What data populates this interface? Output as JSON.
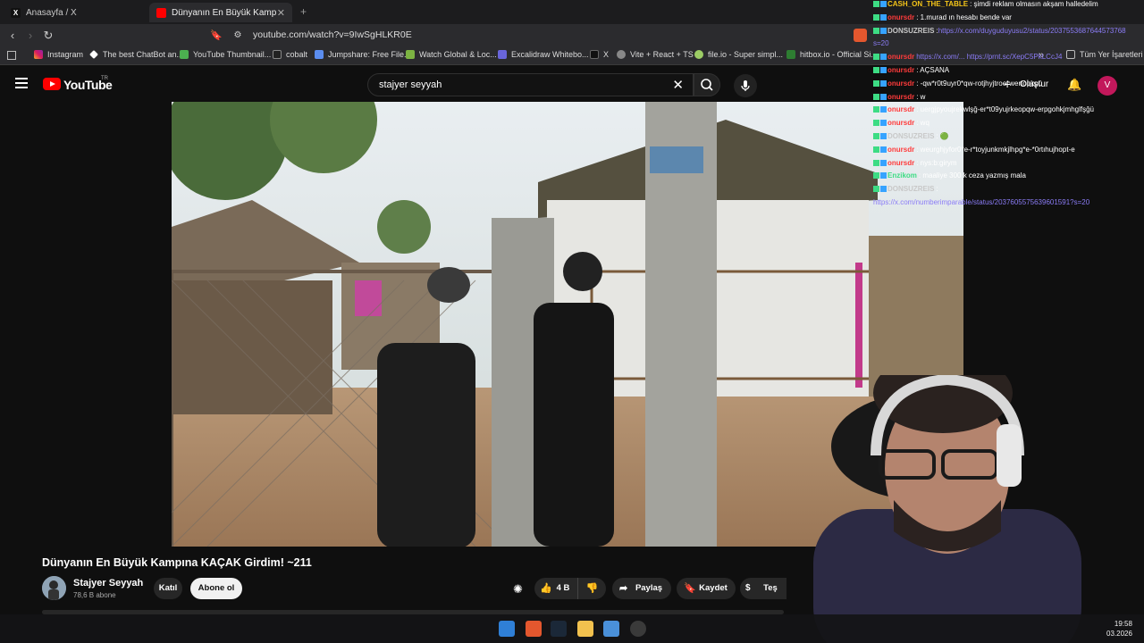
{
  "browser": {
    "tabs": [
      {
        "label": "Anasayfa / X",
        "active": false
      },
      {
        "label": "Dünyanın En Büyük Kampına KAÇ",
        "active": true
      }
    ],
    "url": "youtube.com/watch?v=9IwSgHLKR0E",
    "bookmarks": [
      "Instagram",
      "The best ChatBot an...",
      "YouTube Thumbnail...",
      "cobalt",
      "Jumpshare: Free File...",
      "Watch Global & Loc...",
      "Excalidraw Whitebo...",
      "X",
      "Vite + React + TS",
      "file.io - Super simpl...",
      "hitbox.io - Official Si..."
    ],
    "bookmarks_more": "»",
    "all_bookmarks": "Tüm Yer İşaretleri"
  },
  "youtube": {
    "logo_text": "YouTube",
    "country_code": "TR",
    "search_value": "stajyer seyyah",
    "create_label": "Oluştur",
    "avatar_letter": "V",
    "video": {
      "title": "Dünyanın En Büyük Kampına KAÇAK Girdim! ~211",
      "channel_name": "Stajyer Seyyah",
      "subscribers": "78,6 B abone",
      "join_label": "Katıl",
      "subscribe_label": "Abone ol",
      "likes": "4 B",
      "share_label": "Paylaş",
      "save_label": "Kaydet",
      "thanks_label": "Teş"
    }
  },
  "chat": [
    {
      "user": "CASH_ON_THE_TABLE",
      "user_color": "#f5c518",
      "msg": ": şimdi reklam olmasın akşam halledelim"
    },
    {
      "user": "onursdr",
      "user_color": "#ff3b3b",
      "msg": ": 1.murad ın hesabı bende var"
    },
    {
      "user": "DONSUZREIS",
      "user_color": "#c8c8c8",
      "msg": ": ",
      "link": "https://x.com/duyguduyusu2/status/2037553687644573768"
    },
    {
      "user": "",
      "user_color": "#8b7cf6",
      "msg": "",
      "link": "s=20"
    },
    {
      "user": "onursdr",
      "user_color": "#ff3b3b",
      "msg": "",
      "link": "https://x.com/... https://prnt.sc/XepC5PkLCcJ4"
    },
    {
      "user": "onursdr",
      "user_color": "#ff3b3b",
      "msg": ": AÇSANA"
    },
    {
      "user": "onursdr",
      "user_color": "#ff3b3b",
      "msg": ": -qw*r0t9uyr0*qw-rotjhyjtroe*wertopkpü"
    },
    {
      "user": "onursdr",
      "user_color": "#ff3b3b",
      "msg": ": w"
    },
    {
      "user": "onursdr",
      "user_color": "#ff3b3b",
      "msg": ": uergjpyoujrekwlşğ-er*t09yujrkeopqw-erpgohkjmhglfşğü"
    },
    {
      "user": "onursdr",
      "user_color": "#ff3b3b",
      "msg": ": wq"
    },
    {
      "user": "DONSUZREIS",
      "user_color": "#c8c8c8",
      "msg": ": 🟢"
    },
    {
      "user": "onursdr",
      "user_color": "#ff3b3b",
      "msg": ": weurghjyfor0*e-r*toyjunkmkjlhpg*e-*0rtıhujhopt-e"
    },
    {
      "user": "onursdr",
      "user_color": "#ff3b3b",
      "msg": ": nys:b:girym"
    },
    {
      "user": "Enzikom",
      "user_color": "#3ddc84",
      "msg": ": maaliye 300 k ceza yazmış mala"
    },
    {
      "user": "DONSUZREIS",
      "user_color": "#c8c8c8",
      "msg": ": "
    },
    {
      "user": "",
      "user_color": "#8b7cf6",
      "msg": "",
      "link": "https://x.com/numberimparable/status/2037605575639601591?s=20"
    }
  ],
  "clock": {
    "time": "19:58",
    "date": "03.2026"
  },
  "colors": {
    "yt_red": "#ff0000",
    "bg": "#0f0f0f",
    "chip": "#272727",
    "link": "#8b7cf6"
  }
}
